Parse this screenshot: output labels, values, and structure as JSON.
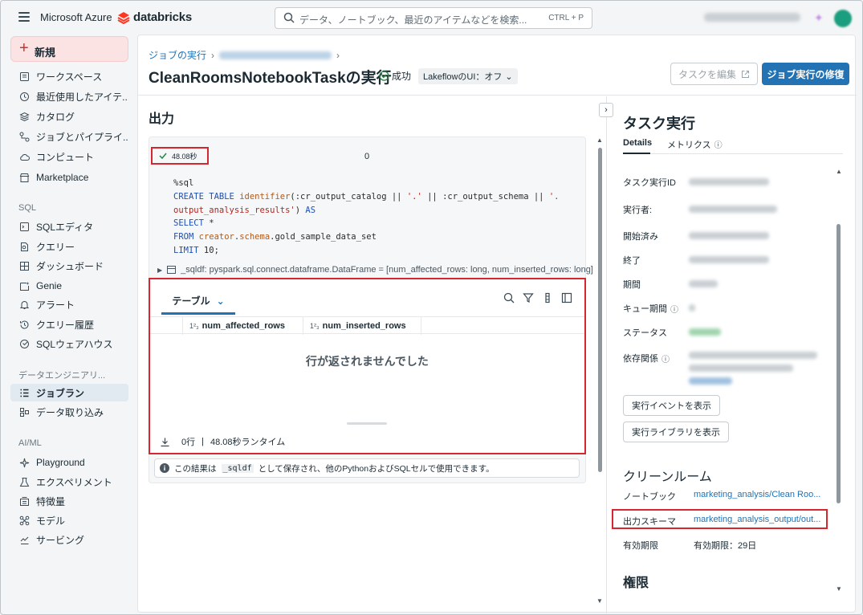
{
  "topbar": {
    "azure_label": "Microsoft Azure",
    "brand_label": "databricks",
    "search_placeholder": "データ、ノートブック、最近のアイテムなどを検索...",
    "search_shortcut": "CTRL + P"
  },
  "sidebar": {
    "new_label": "新規",
    "items": [
      {
        "label": "ワークスペース",
        "icon": "folder-icon"
      },
      {
        "label": "最近使用したアイテ...",
        "icon": "clock-icon"
      },
      {
        "label": "カタログ",
        "icon": "catalog-icon"
      },
      {
        "label": "ジョブとパイプライ...",
        "icon": "workflow-icon"
      },
      {
        "label": "コンピュート",
        "icon": "cloud-icon"
      },
      {
        "label": "Marketplace",
        "icon": "marketplace-icon"
      }
    ],
    "sql_section": "SQL",
    "sql_items": [
      {
        "label": "SQLエディタ",
        "icon": "sql-editor-icon"
      },
      {
        "label": "クエリー",
        "icon": "query-icon"
      },
      {
        "label": "ダッシュボード",
        "icon": "dashboard-icon"
      },
      {
        "label": "Genie",
        "icon": "genie-icon"
      },
      {
        "label": "アラート",
        "icon": "bell-icon"
      },
      {
        "label": "クエリー履歴",
        "icon": "history-icon"
      },
      {
        "label": "SQLウェアハウス",
        "icon": "warehouse-icon"
      }
    ],
    "de_section": "データエンジニアリ...",
    "de_items": [
      {
        "label": "ジョブラン",
        "icon": "job-runs-icon",
        "active": true
      },
      {
        "label": "データ取り込み",
        "icon": "ingest-icon"
      }
    ],
    "ml_section": "AI/ML",
    "ml_items": [
      {
        "label": "Playground",
        "icon": "playground-icon"
      },
      {
        "label": "エクスペリメント",
        "icon": "flask-icon"
      },
      {
        "label": "特徴量",
        "icon": "feature-icon"
      },
      {
        "label": "モデル",
        "icon": "model-icon"
      },
      {
        "label": "サービング",
        "icon": "serving-icon"
      }
    ]
  },
  "header": {
    "breadcrumb_root": "ジョブの実行",
    "title": "CleanRoomsNotebookTaskの実行",
    "status": "成功",
    "lakeflow": "LakeflowのUI：オフ",
    "edit_task": "タスクを編集",
    "repair_run": "ジョブ実行の修復"
  },
  "output": {
    "title": "出力",
    "duration": "48.08秒",
    "exec_count": "0",
    "code_lines": [
      "%sql",
      "CREATE TABLE identifier(:cr_output_catalog || '.' || :cr_output_schema || '.",
      "output_analysis_results') AS",
      "SELECT *",
      "FROM creator.schema.gold_sample_data_set",
      "LIMIT 10;"
    ],
    "sqldf_text": "_sqldf:  pyspark.sql.connect.dataframe.DataFrame = [num_affected_rows: long, num_inserted_rows: long]",
    "result_tab": "テーブル",
    "columns": [
      "num_affected_rows",
      "num_inserted_rows"
    ],
    "column_type_badge": "1²₃",
    "no_rows": "行が返されませんでした",
    "footer_rows": "0行",
    "footer_runtime": "48.08秒ランタイム",
    "info_prefix": "この結果は",
    "info_code": "_sqldf",
    "info_suffix": "として保存され、他のPythonおよびSQLセルで使用できます。"
  },
  "task_panel": {
    "title": "タスク実行",
    "tab_details": "Details",
    "tab_metrics": "メトリクス",
    "labels": {
      "task_run_id": "タスク実行ID",
      "run_by": "実行者:",
      "started": "開始済み",
      "ended": "終了",
      "duration": "期間",
      "queue_duration": "キュー期間",
      "status": "ステータス",
      "dependencies": "依存関係"
    },
    "btn_events": "実行イベントを表示",
    "btn_libraries": "実行ライブラリを表示",
    "cleanroom_title": "クリーンルーム",
    "notebook_label": "ノートブック",
    "notebook_value": "marketing_analysis/Clean Roo...",
    "schema_label": "出力スキーマ",
    "schema_value": "marketing_analysis_output/out...",
    "expiry_label": "有効期限",
    "expiry_value": "有効期限：29日",
    "permissions_title": "権限"
  },
  "colors": {
    "accent": "#2272b4",
    "highlight": "#d6262e",
    "success": "#1f8a3b"
  }
}
